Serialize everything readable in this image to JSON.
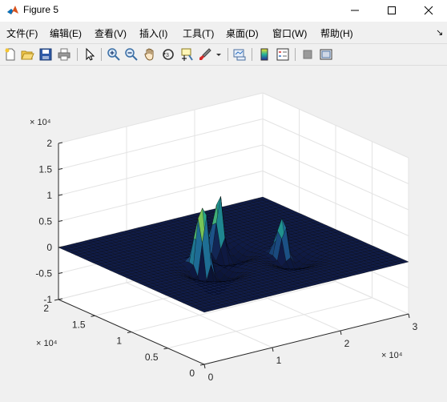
{
  "window": {
    "title": "Figure 5"
  },
  "menu": {
    "file": "文件(F)",
    "edit": "编辑(E)",
    "view": "查看(V)",
    "insert": "插入(I)",
    "tools": "工具(T)",
    "desktop": "桌面(D)",
    "window": "窗口(W)",
    "help": "帮助(H)",
    "overflow": "↘"
  },
  "toolbar": {
    "icons": [
      "new-figure-icon",
      "open-file-icon",
      "save-icon",
      "print-icon",
      "pointer-icon",
      "zoom-in-icon",
      "zoom-out-icon",
      "pan-icon",
      "rotate-3d-icon",
      "data-cursor-icon",
      "brush-icon",
      "brush-dropdown-icon",
      "link-plot-icon",
      "colorbar-icon",
      "legend-icon",
      "hide-plot-tools-icon",
      "show-plot-tools-icon"
    ]
  },
  "colors": {
    "surface_low": "#0a0f3a",
    "surface_mid": "#1f9e89",
    "surface_high": "#e8d422",
    "axis_bg": "#ffffff"
  },
  "chart_data": {
    "type": "surface",
    "z_exponent_label": "× 10⁴",
    "x_exponent_label": "× 10⁴",
    "y_exponent_label": "× 10⁴",
    "xlim": [
      0,
      3
    ],
    "ylim": [
      0,
      2
    ],
    "zlim": [
      -1,
      2
    ],
    "xticks": [
      "0",
      "1",
      "2",
      "3"
    ],
    "yticks": [
      "0",
      "0.5",
      "1",
      "1.5",
      "2"
    ],
    "zticks": [
      "-1",
      "-0.5",
      "0",
      "0.5",
      "1",
      "1.5",
      "2"
    ],
    "grid": true,
    "peaks": [
      {
        "x": 1.0,
        "y": 1.0,
        "z": 1.0
      },
      {
        "x": 1.05,
        "y": 0.95,
        "z": 0.95
      },
      {
        "x": 1.55,
        "y": 1.25,
        "z": 1.25
      },
      {
        "x": 2.0,
        "y": 0.8,
        "z": 0.9
      }
    ]
  }
}
